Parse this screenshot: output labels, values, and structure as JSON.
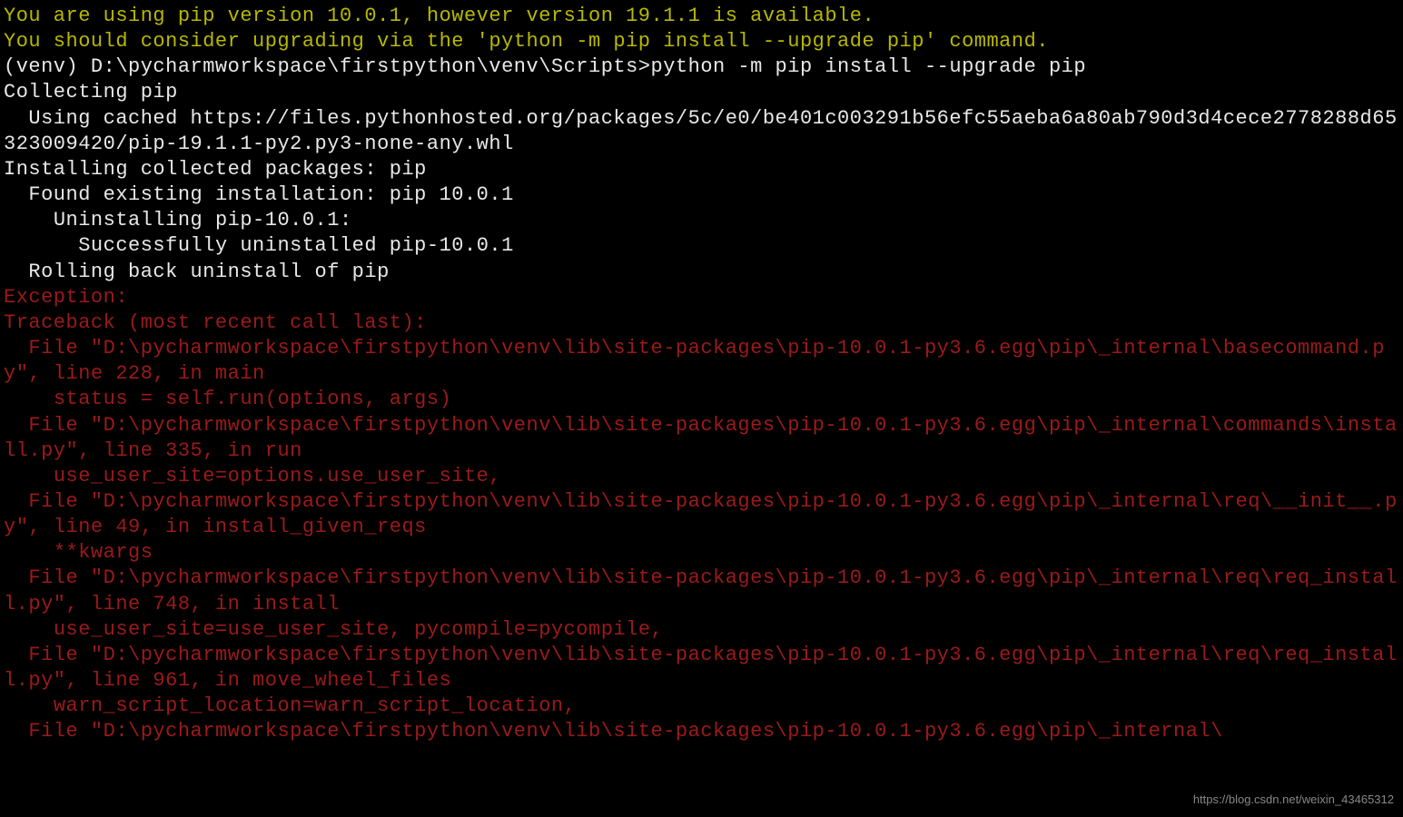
{
  "terminal": {
    "warning_lines": [
      "You are using pip version 10.0.1, however version 19.1.1 is available.",
      "You should consider upgrading via the 'python -m pip install --upgrade pip' command."
    ],
    "blank": "",
    "prompt_line": "(venv) D:\\pycharmworkspace\\firstpython\\venv\\Scripts>python -m pip install --upgrade pip",
    "normal_lines": [
      "Collecting pip",
      "  Using cached https://files.pythonhosted.org/packages/5c/e0/be401c003291b56efc55aeba6a80ab790d3d4cece2778288d65323009420/pip-19.1.1-py2.py3-none-any.whl",
      "Installing collected packages: pip",
      "  Found existing installation: pip 10.0.1",
      "    Uninstalling pip-10.0.1:",
      "      Successfully uninstalled pip-10.0.1",
      "  Rolling back uninstall of pip"
    ],
    "error_lines": [
      "Exception:",
      "Traceback (most recent call last):",
      "  File \"D:\\pycharmworkspace\\firstpython\\venv\\lib\\site-packages\\pip-10.0.1-py3.6.egg\\pip\\_internal\\basecommand.py\", line 228, in main",
      "    status = self.run(options, args)",
      "  File \"D:\\pycharmworkspace\\firstpython\\venv\\lib\\site-packages\\pip-10.0.1-py3.6.egg\\pip\\_internal\\commands\\install.py\", line 335, in run",
      "    use_user_site=options.use_user_site,",
      "  File \"D:\\pycharmworkspace\\firstpython\\venv\\lib\\site-packages\\pip-10.0.1-py3.6.egg\\pip\\_internal\\req\\__init__.py\", line 49, in install_given_reqs",
      "    **kwargs",
      "  File \"D:\\pycharmworkspace\\firstpython\\venv\\lib\\site-packages\\pip-10.0.1-py3.6.egg\\pip\\_internal\\req\\req_install.py\", line 748, in install",
      "    use_user_site=use_user_site, pycompile=pycompile,",
      "  File \"D:\\pycharmworkspace\\firstpython\\venv\\lib\\site-packages\\pip-10.0.1-py3.6.egg\\pip\\_internal\\req\\req_install.py\", line 961, in move_wheel_files",
      "    warn_script_location=warn_script_location,",
      "  File \"D:\\pycharmworkspace\\firstpython\\venv\\lib\\site-packages\\pip-10.0.1-py3.6.egg\\pip\\_internal\\"
    ]
  },
  "watermark": "https://blog.csdn.net/weixin_43465312"
}
